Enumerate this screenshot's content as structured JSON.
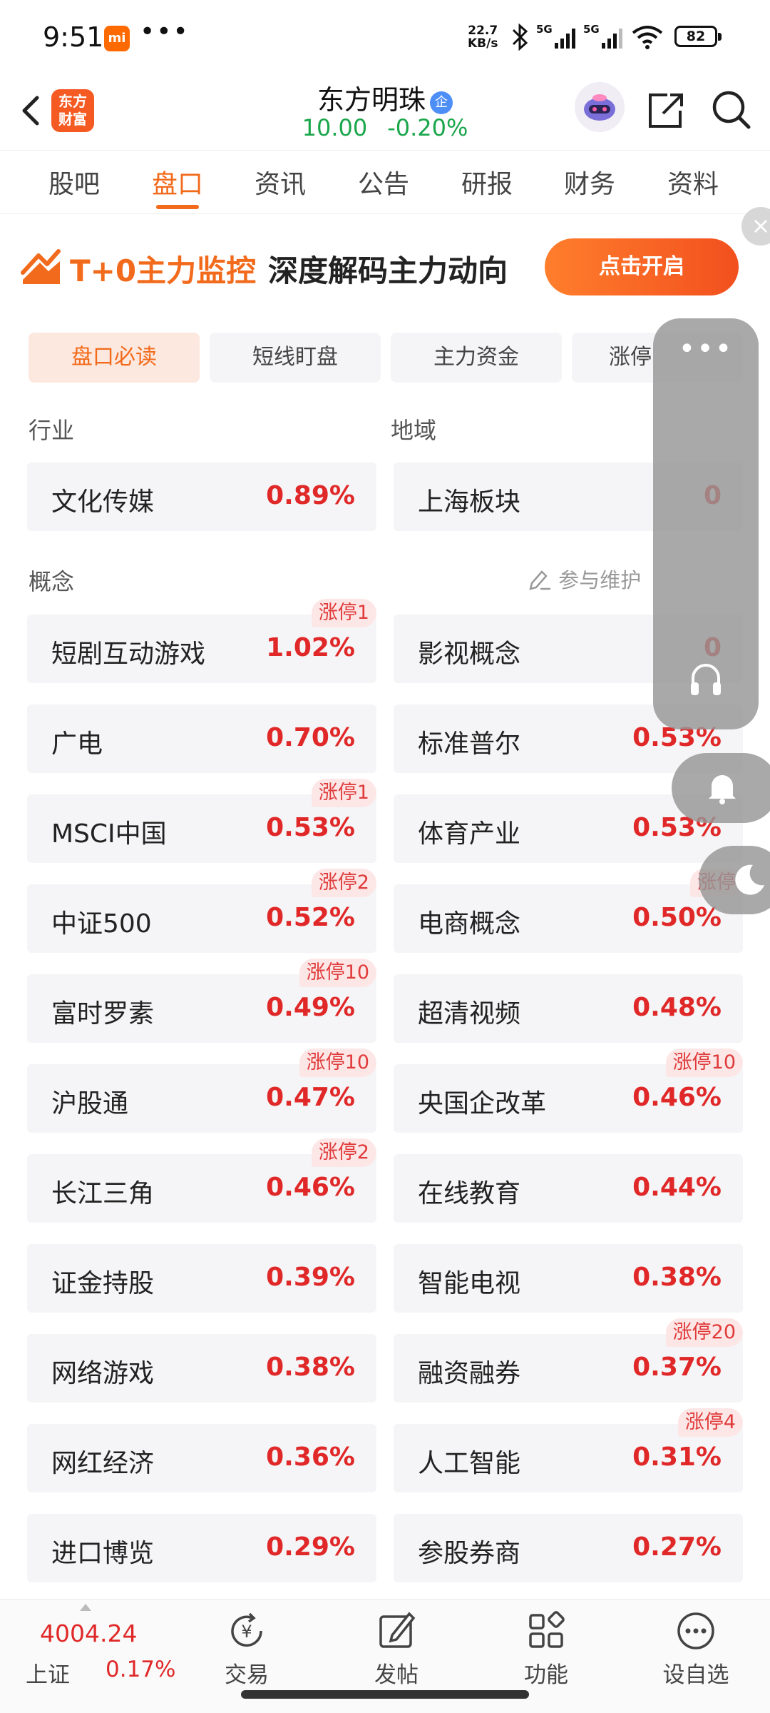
{
  "status_bar": {
    "time": "9:51",
    "mi_label": "mi",
    "more": "•••",
    "net_speed_top": "22.7",
    "net_speed_bottom": "KB/s",
    "signal_1": "5G",
    "signal_2": "5G",
    "battery": "82"
  },
  "header": {
    "logo_line1": "东方",
    "logo_line2": "财富",
    "stock_name": "东方明珠",
    "badge": "企",
    "price": "10.00",
    "change": "-0.20%"
  },
  "tabs": [
    "股吧",
    "盘口",
    "资讯",
    "公告",
    "研报",
    "财务",
    "资料"
  ],
  "banner": {
    "highlight": "T+0主力监控",
    "rest": "深度解码主力动向",
    "button": "点击开启",
    "close": "×"
  },
  "chips": [
    "盘口必读",
    "短线盯盘",
    "主力资金",
    "涨停"
  ],
  "industry": {
    "label": "行业",
    "name": "文化传媒",
    "pct": "0.89%"
  },
  "region": {
    "label": "地域",
    "name": "上海板块",
    "pct": "0"
  },
  "concepts_label": "概念",
  "maintain_label": "参与维护",
  "concepts": [
    {
      "name": "短剧互动游戏",
      "pct": "1.02%",
      "tag": "涨停1"
    },
    {
      "name": "影视概念",
      "pct": "0",
      "tag": ""
    },
    {
      "name": "广电",
      "pct": "0.70%",
      "tag": ""
    },
    {
      "name": "标准普尔",
      "pct": "0.53%",
      "tag": ""
    },
    {
      "name": "MSCI中国",
      "pct": "0.53%",
      "tag": "涨停1"
    },
    {
      "name": "体育产业",
      "pct": "0.53%",
      "tag": ""
    },
    {
      "name": "中证500",
      "pct": "0.52%",
      "tag": "涨停2"
    },
    {
      "name": "电商概念",
      "pct": "0.50%",
      "tag": "涨停"
    },
    {
      "name": "富时罗素",
      "pct": "0.49%",
      "tag": "涨停10"
    },
    {
      "name": "超清视频",
      "pct": "0.48%",
      "tag": ""
    },
    {
      "name": "沪股通",
      "pct": "0.47%",
      "tag": "涨停10"
    },
    {
      "name": "央国企改革",
      "pct": "0.46%",
      "tag": "涨停10"
    },
    {
      "name": "长江三角",
      "pct": "0.46%",
      "tag": "涨停2"
    },
    {
      "name": "在线教育",
      "pct": "0.44%",
      "tag": ""
    },
    {
      "name": "证金持股",
      "pct": "0.39%",
      "tag": ""
    },
    {
      "name": "智能电视",
      "pct": "0.38%",
      "tag": ""
    },
    {
      "name": "网络游戏",
      "pct": "0.38%",
      "tag": ""
    },
    {
      "name": "融资融券",
      "pct": "0.37%",
      "tag": "涨停20"
    },
    {
      "name": "网红经济",
      "pct": "0.36%",
      "tag": ""
    },
    {
      "name": "人工智能",
      "pct": "0.31%",
      "tag": "涨停4"
    },
    {
      "name": "进口博览",
      "pct": "0.29%",
      "tag": ""
    },
    {
      "name": "参股券商",
      "pct": "0.27%",
      "tag": ""
    }
  ],
  "float": {
    "dots": "•••"
  },
  "bottom_nav": {
    "index_value": "4004.24",
    "index_name": "上证",
    "index_pct": "0.17%",
    "trade": "交易",
    "post": "发帖",
    "functions": "功能",
    "watchlist": "设自选",
    "yen_symbol": "¥"
  },
  "colors": {
    "accent": "#f26a1b",
    "up": "#e02828",
    "down": "#1aa64b"
  }
}
